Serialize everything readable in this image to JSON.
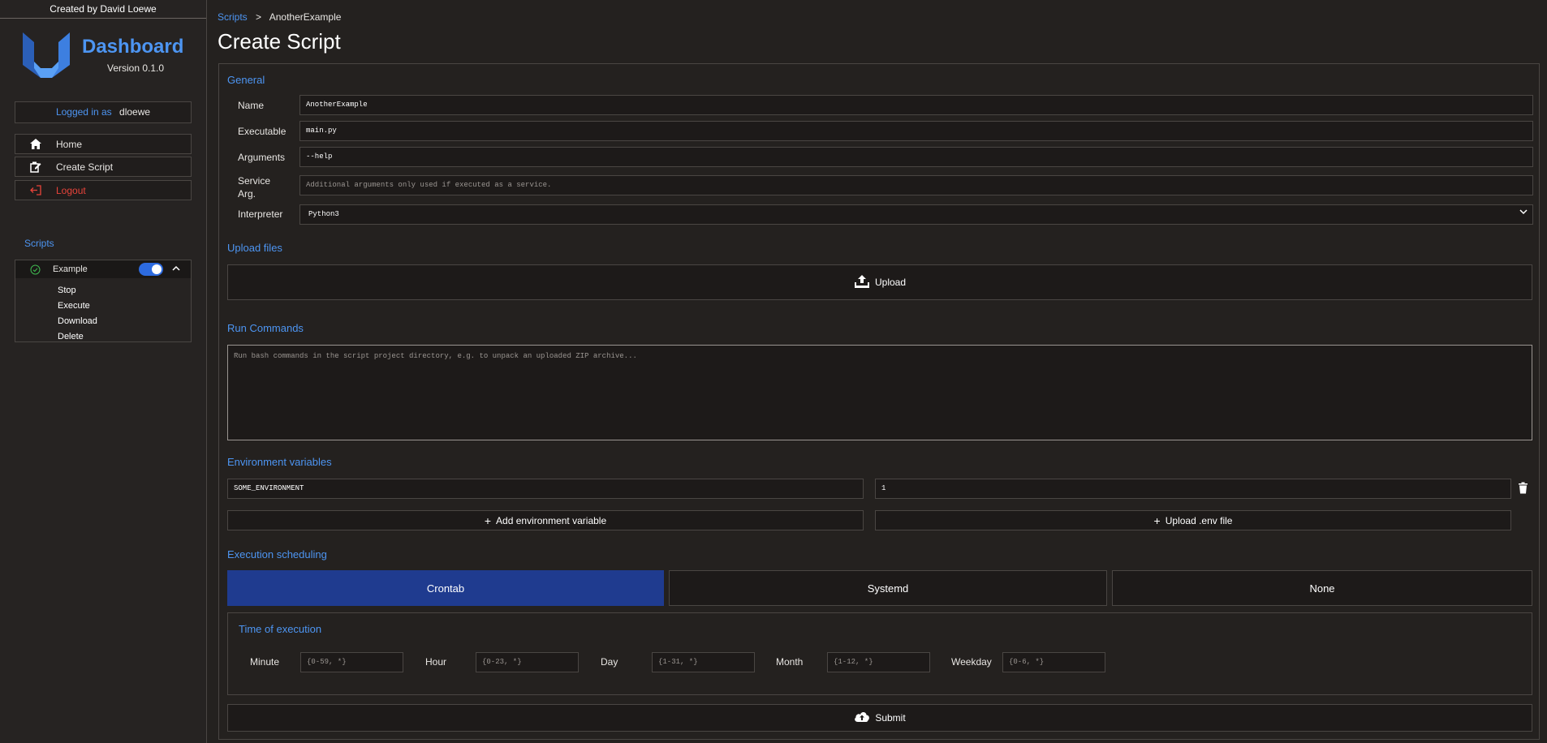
{
  "sidebar": {
    "credit": "Created by David Loewe",
    "brand_title": "Dashboard",
    "brand_version": "Version 0.1.0",
    "login_label": "Logged in as",
    "login_user": "dloewe",
    "nav": [
      {
        "label": "Home",
        "icon": "home-icon"
      },
      {
        "label": "Create Script",
        "icon": "create-script-icon"
      },
      {
        "label": "Logout",
        "icon": "logout-icon"
      }
    ],
    "scripts_heading": "Scripts",
    "script": {
      "name": "Example",
      "enabled": true,
      "actions": [
        "Stop",
        "Execute",
        "Download",
        "Delete"
      ]
    }
  },
  "breadcrumb": {
    "root": "Scripts",
    "separator": ">",
    "current": "AnotherExample"
  },
  "page_title": "Create Script",
  "general": {
    "heading": "General",
    "name_label": "Name",
    "name_value": "AnotherExample",
    "executable_label": "Executable",
    "executable_value": "main.py",
    "arguments_label": "Arguments",
    "arguments_value": "--help",
    "service_arg_label_1": "Service",
    "service_arg_label_2": "Arg.",
    "service_arg_placeholder": "Additional arguments only used if executed as a service.",
    "interpreter_label": "Interpreter",
    "interpreter_value": "Python3"
  },
  "upload": {
    "heading": "Upload files",
    "button_label": "Upload"
  },
  "run_commands": {
    "heading": "Run Commands",
    "placeholder": "Run bash commands in the script project directory, e.g. to unpack an uploaded ZIP archive..."
  },
  "env": {
    "heading": "Environment variables",
    "key": "SOME_ENVIRONMENT",
    "value": "1",
    "add_label": "Add environment variable",
    "upload_env_label": "Upload .env file"
  },
  "scheduling": {
    "heading": "Execution scheduling",
    "tabs": [
      "Crontab",
      "Systemd",
      "None"
    ],
    "active_tab": "Crontab",
    "time_heading": "Time of execution",
    "fields": [
      {
        "label": "Minute",
        "placeholder": "{0-59, *}"
      },
      {
        "label": "Hour",
        "placeholder": "{0-23, *}"
      },
      {
        "label": "Day",
        "placeholder": "{1-31, *}"
      },
      {
        "label": "Month",
        "placeholder": "{1-12, *}"
      },
      {
        "label": "Weekday",
        "placeholder": "{0-6, *}"
      }
    ]
  },
  "submit_label": "Submit",
  "colors": {
    "accent": "#4d95f2",
    "active_tab": "#1f3b8f",
    "logout": "#e8433a",
    "toggle": "#2d6be0"
  }
}
